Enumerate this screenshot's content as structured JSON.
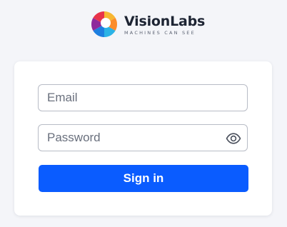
{
  "brand": {
    "name": "VisionLabs",
    "tagline": "MACHINES CAN SEE",
    "logo_icon": "visionlabs-ring-logo"
  },
  "form": {
    "email_placeholder": "Email",
    "email_value": "",
    "password_placeholder": "Password",
    "password_value": "",
    "visibility_icon": "eye-icon",
    "signin_label": "Sign in"
  },
  "colors": {
    "background": "#f4f5f9",
    "card": "#ffffff",
    "primary_button": "#0a5cff",
    "input_border": "#b8bcc6",
    "brand_text": "#1d2433"
  }
}
